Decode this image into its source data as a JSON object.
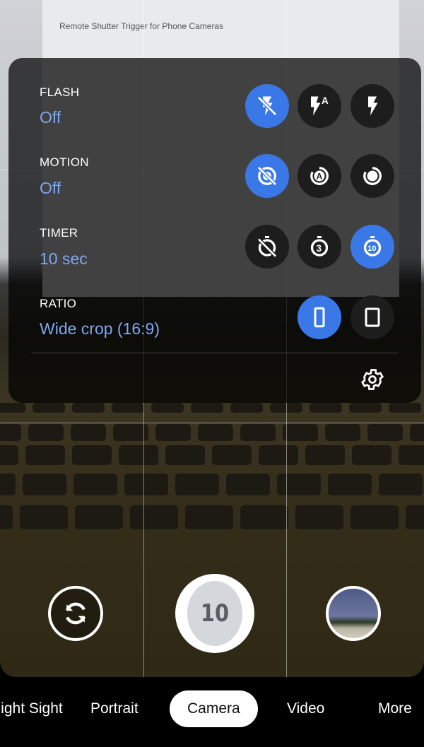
{
  "viewfinder": {
    "doc_title": "Remote Shutter Trigger for Phone Cameras"
  },
  "settings": {
    "flash": {
      "label": "FLASH",
      "value": "Off",
      "options": [
        {
          "icon": "flash-off-icon",
          "selected": true
        },
        {
          "icon": "flash-auto-icon",
          "selected": false
        },
        {
          "icon": "flash-on-icon",
          "selected": false
        }
      ]
    },
    "motion": {
      "label": "MOTION",
      "value": "Off",
      "options": [
        {
          "icon": "motion-off-icon",
          "selected": true
        },
        {
          "icon": "motion-auto-icon",
          "selected": false
        },
        {
          "icon": "motion-on-icon",
          "selected": false
        }
      ]
    },
    "timer": {
      "label": "TIMER",
      "value": "10 sec",
      "options": [
        {
          "icon": "timer-off-icon",
          "selected": false
        },
        {
          "icon": "timer-3-icon",
          "selected": false,
          "text": "3"
        },
        {
          "icon": "timer-10-icon",
          "selected": true,
          "text": "10"
        }
      ]
    },
    "ratio": {
      "label": "RATIO",
      "value": "Wide crop (16:9)",
      "options": [
        {
          "icon": "ratio-wide-icon",
          "selected": true
        },
        {
          "icon": "ratio-full-icon",
          "selected": false
        }
      ]
    },
    "settings_icon": "gear-icon"
  },
  "controls": {
    "shutter_countdown": "10",
    "flip_icon": "switch-camera-icon",
    "thumbnail": "last-photo-thumbnail"
  },
  "modes": [
    "Night Sight",
    "Portrait",
    "Camera",
    "Video",
    "More"
  ],
  "active_mode": "Camera",
  "colors": {
    "accent": "#3b78e7",
    "value_text": "#7fa6ef",
    "button_bg": "#1d1d1d"
  }
}
